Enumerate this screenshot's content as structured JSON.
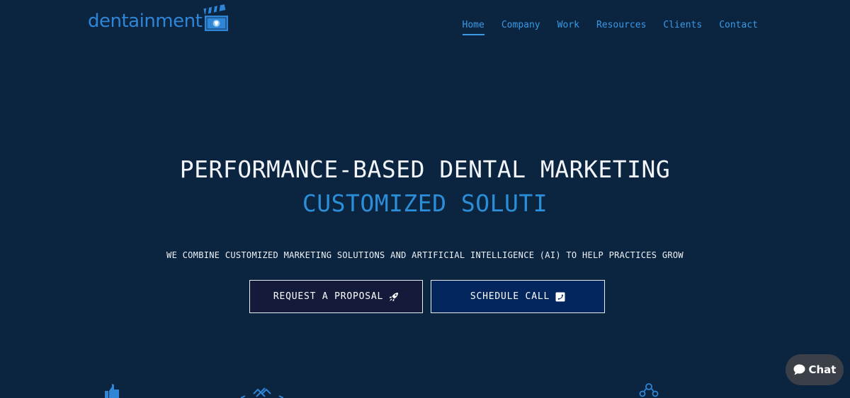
{
  "brand": {
    "logo_text": "dentainment",
    "accent_color": "#2f86d6"
  },
  "nav": {
    "items": [
      {
        "label": "Home",
        "active": true
      },
      {
        "label": "Company",
        "active": false
      },
      {
        "label": "Work",
        "active": false
      },
      {
        "label": "Resources",
        "active": false
      },
      {
        "label": "Clients",
        "active": false
      },
      {
        "label": "Contact",
        "active": false
      }
    ]
  },
  "hero": {
    "title": "PERFORMANCE-BASED DENTAL MARKETING",
    "subtitle": "CUSTOMIZED SOLUTI",
    "description": "WE COMBINE CUSTOMIZED MARKETING SOLUTIONS AND ARTIFICIAL INTELLIGENCE (AI) TO HELP PRACTICES GROW",
    "buttons": {
      "proposal_label": "REQUEST A PROPOSAL",
      "proposal_icon": "rocket-icon",
      "call_label": "SCHEDULE CALL",
      "call_icon": "phone-square-icon"
    }
  },
  "chat": {
    "label": "Chat",
    "icon": "chat-bubble-icon"
  },
  "features": {
    "icons": [
      "thumbs-up-icon",
      "diamond-network-icon",
      "team-icon"
    ]
  },
  "colors": {
    "background": "#0b2440",
    "title": "#f2f5f9",
    "subtitle": "#2b8ed8",
    "nav": "#3a9ae6"
  }
}
